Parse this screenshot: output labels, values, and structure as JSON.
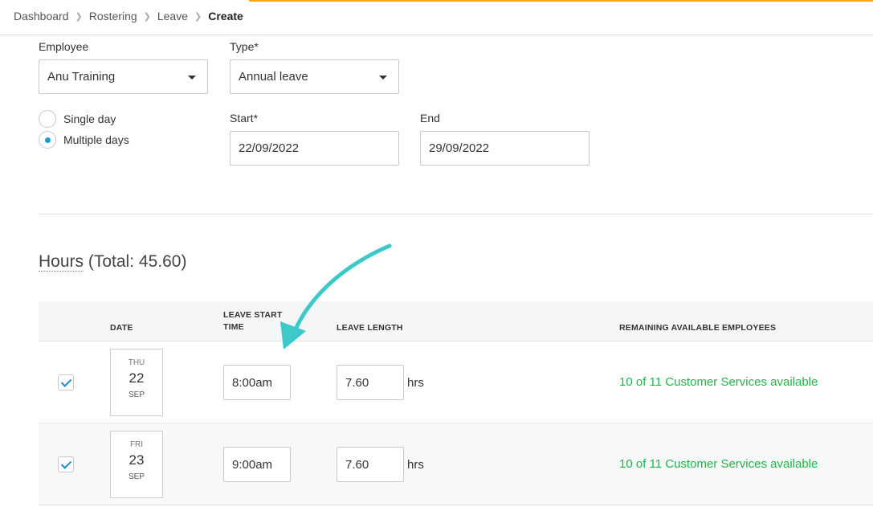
{
  "breadcrumb": {
    "items": [
      "Dashboard",
      "Rostering",
      "Leave"
    ],
    "current": "Create"
  },
  "form": {
    "employee_label": "Employee",
    "employee_value": "Anu Training",
    "type_label": "Type",
    "type_value": "Annual leave",
    "duration_options": [
      {
        "label": "Single day",
        "checked": false
      },
      {
        "label": "Multiple days",
        "checked": true
      }
    ],
    "start_label": "Start",
    "start_value": "22/09/2022",
    "end_label": "End",
    "end_value": "29/09/2022"
  },
  "hours": {
    "title_word": "Hours",
    "total_text": "(Total: 45.60)",
    "columns": {
      "date": "DATE",
      "leave_start_time_line1": "LEAVE START",
      "leave_start_time_line2": "TIME",
      "leave_length": "LEAVE LENGTH",
      "remaining": "REMAINING AVAILABLE EMPLOYEES"
    },
    "rows": [
      {
        "checked": true,
        "dow": "THU",
        "day": "22",
        "month": "SEP",
        "start_time": "8:00am",
        "length": "7.60",
        "unit": "hrs",
        "availability": "10 of 11 Customer Services available"
      },
      {
        "checked": true,
        "dow": "FRI",
        "day": "23",
        "month": "SEP",
        "start_time": "9:00am",
        "length": "7.60",
        "unit": "hrs",
        "availability": "10 of 11 Customer Services available"
      }
    ]
  },
  "colors": {
    "accent_bar": "#f0a81e",
    "radio_selected": "#1a9bd8",
    "available_green": "#24b34a",
    "annotation_arrow": "#3cc9c9"
  },
  "icons": {
    "dropdown": "caret-down-icon",
    "breadcrumb_separator": "chevron-right-icon",
    "checkbox": "checkmark-icon",
    "annotation": "curved-arrow-icon"
  }
}
